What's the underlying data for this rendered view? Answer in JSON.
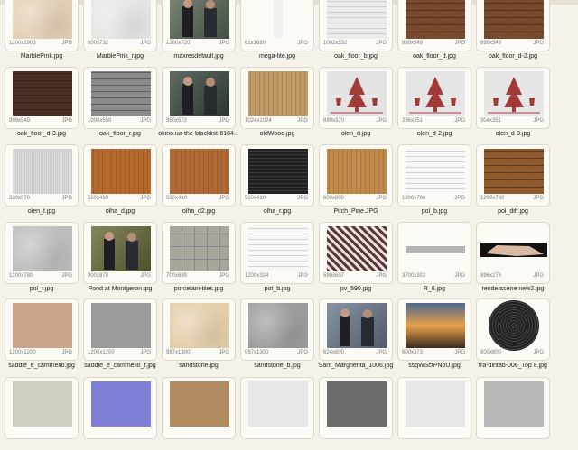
{
  "window": {
    "title": ""
  },
  "rows": [
    [
      {
        "name": "MarblePink.jpg",
        "dims": "1200x1903",
        "type": "JPG",
        "bg": "#e3cfb4",
        "pattern": "marble"
      },
      {
        "name": "MarblePink_r.jpg",
        "dims": "600x732",
        "type": "JPG",
        "bg": "#e6e6e6",
        "pattern": "marble"
      },
      {
        "name": "maxresdefault.jpg",
        "dims": "1280x720",
        "type": "JPG",
        "bg": "#5a6a58",
        "pattern": "photo"
      },
      {
        "name": "mega-lite.jpg",
        "dims": "61x1680",
        "type": "JPG",
        "bg": "#f1f1f1",
        "pattern": "strip"
      },
      {
        "name": "oak_floor_b.jpg",
        "dims": "1002x532",
        "type": "JPG",
        "bg": "#e8e8e8",
        "pattern": "planks-light"
      },
      {
        "name": "oak_floor_d.jpg",
        "dims": "999x549",
        "type": "JPG",
        "bg": "#7a4a2c",
        "pattern": "planks"
      },
      {
        "name": "oak_floor_d-2.jpg",
        "dims": "999x549",
        "type": "JPG",
        "bg": "#7a4a2c",
        "pattern": "planks"
      }
    ],
    [
      {
        "name": "oak_floor_d-3.jpg",
        "dims": "999x549",
        "type": "JPG",
        "bg": "#4a2e22",
        "pattern": "planks"
      },
      {
        "name": "oak_floor_r.jpg",
        "dims": "1000x550",
        "type": "JPG",
        "bg": "#7d7d7d",
        "pattern": "planks-grey"
      },
      {
        "name": "okino.ua-the-blacklist-6184...",
        "dims": "950x572",
        "type": "JPG",
        "bg": "#3b4a3e",
        "pattern": "photo"
      },
      {
        "name": "oldWood.jpg",
        "dims": "1024x1024",
        "type": "JPG",
        "bg": "#c29a66",
        "pattern": "wood"
      },
      {
        "name": "olen_d.jpg",
        "dims": "880x370",
        "type": "JPG",
        "bg": "#e3e3e3",
        "pattern": "deer"
      },
      {
        "name": "olen_d-2.jpg",
        "dims": "296x351",
        "type": "JPG",
        "bg": "#e6e6e6",
        "pattern": "deer"
      },
      {
        "name": "olen_d-3.jpg",
        "dims": "304x351",
        "type": "JPG",
        "bg": "#e6e6e6",
        "pattern": "deer"
      }
    ],
    [
      {
        "name": "olen_t.jpg",
        "dims": "880x370",
        "type": "JPG",
        "bg": "#d6d6d6",
        "pattern": "fabric"
      },
      {
        "name": "olha_d.jpg",
        "dims": "560x410",
        "type": "JPG",
        "bg": "#b5692c",
        "pattern": "wood"
      },
      {
        "name": "olha_d2.jpg",
        "dims": "560x410",
        "type": "JPG",
        "bg": "#b06a36",
        "pattern": "wood"
      },
      {
        "name": "olha_r.jpg",
        "dims": "560x410",
        "type": "JPG",
        "bg": "#1d1d1d",
        "pattern": "dark"
      },
      {
        "name": "Pitch_Pine.JPG",
        "dims": "600x800",
        "type": "JPG",
        "bg": "#c18a4a",
        "pattern": "wood"
      },
      {
        "name": "pol_b.jpg",
        "dims": "1200x780",
        "type": "JPG",
        "bg": "#f2f2f2",
        "pattern": "lines"
      },
      {
        "name": "pol_diff.jpg",
        "dims": "1200x780",
        "type": "JPG",
        "bg": "#8e5a2e",
        "pattern": "planks"
      }
    ],
    [
      {
        "name": "pol_r.jpg",
        "dims": "1200x780",
        "type": "JPG",
        "bg": "#bdbdbd",
        "pattern": "marble"
      },
      {
        "name": "Pond at Montgeron.jpg",
        "dims": "900x878",
        "type": "JPG",
        "bg": "#6a6a3a",
        "pattern": "photo"
      },
      {
        "name": "porcelain-tiles.jpg",
        "dims": "700x699",
        "type": "JPG",
        "bg": "#a8a59a",
        "pattern": "tiles"
      },
      {
        "name": "pot_b.jpg",
        "dims": "1200x324",
        "type": "JPG",
        "bg": "#f4f4f4",
        "pattern": "lines"
      },
      {
        "name": "pv_590.jpg",
        "dims": "590x607",
        "type": "JPG",
        "bg": "#4a3a3a",
        "pattern": "knit"
      },
      {
        "name": "R_6.jpg",
        "dims": "3700x302",
        "type": "JPG",
        "bg": "#b4b4b4",
        "pattern": "strip-h"
      },
      {
        "name": "renderscene new2.jpg",
        "dims": "996x276",
        "type": "JPG",
        "bg": "#111111",
        "pattern": "render"
      }
    ],
    [
      {
        "name": "saddle_e_cammello.jpg",
        "dims": "1200x1200",
        "type": "JPG",
        "bg": "#caa58a",
        "pattern": "plain"
      },
      {
        "name": "saddle_e_cammello_r.jpg",
        "dims": "1200x1200",
        "type": "JPG",
        "bg": "#9a9a9a",
        "pattern": "plain"
      },
      {
        "name": "sandstone.jpg",
        "dims": "987x1300",
        "type": "JPG",
        "bg": "#e4ceaa",
        "pattern": "marble"
      },
      {
        "name": "sandstone_b.jpg",
        "dims": "987x1300",
        "type": "JPG",
        "bg": "#9c9c9c",
        "pattern": "marble"
      },
      {
        "name": "Sant_Margherita_1006.jpg",
        "dims": "624x600",
        "type": "JPG",
        "bg": "#6b7b8e",
        "pattern": "photo"
      },
      {
        "name": "ssqWScfPNoU.jpg",
        "dims": "600x373",
        "type": "JPG",
        "bg": "#d07a3a",
        "pattern": "sunset"
      },
      {
        "name": "tra-dintab-006_Top 8.jpg",
        "dims": "600x600",
        "type": "JPG",
        "bg": "#ffffff",
        "pattern": "disc"
      }
    ],
    [
      {
        "name": "",
        "dims": "",
        "type": "",
        "bg": "#d0cdc0",
        "pattern": "plain"
      },
      {
        "name": "",
        "dims": "",
        "type": "",
        "bg": "#7f7fd8",
        "pattern": "plain"
      },
      {
        "name": "",
        "dims": "",
        "type": "",
        "bg": "#b18a5f",
        "pattern": "plain"
      },
      {
        "name": "",
        "dims": "",
        "type": "",
        "bg": "#e8e8e8",
        "pattern": "plain"
      },
      {
        "name": "",
        "dims": "",
        "type": "",
        "bg": "#6c6c6c",
        "pattern": "plain"
      },
      {
        "name": "",
        "dims": "",
        "type": "",
        "bg": "#e7e7e7",
        "pattern": "plain"
      },
      {
        "name": "",
        "dims": "",
        "type": "",
        "bg": "#b9b9b9",
        "pattern": "plain"
      }
    ]
  ]
}
